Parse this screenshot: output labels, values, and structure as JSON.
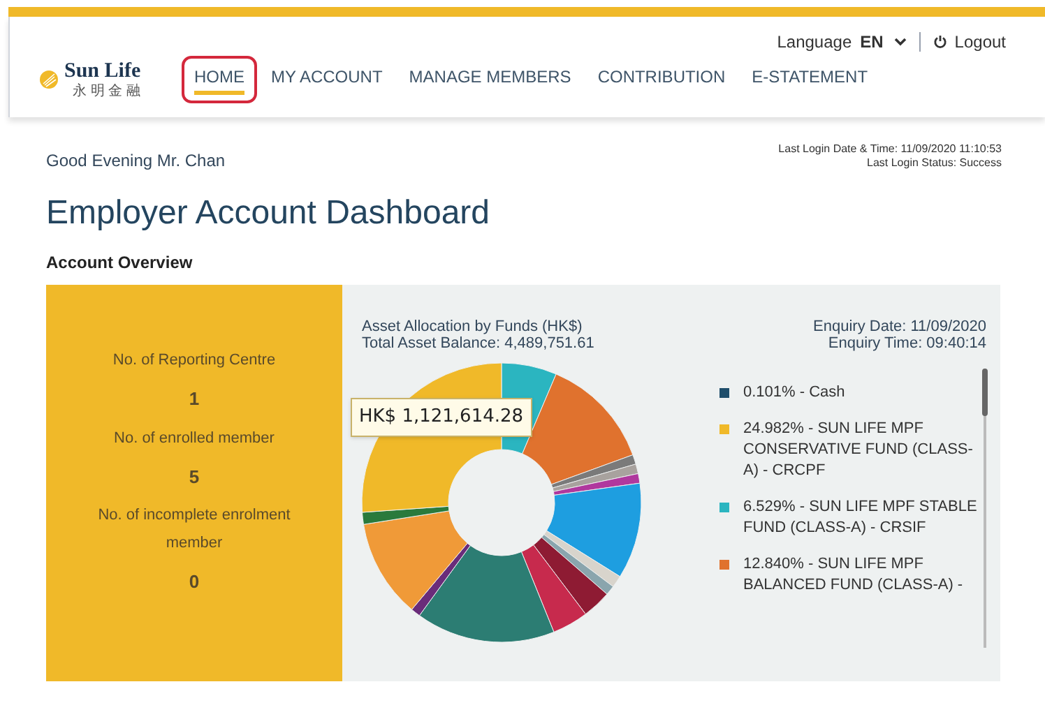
{
  "header": {
    "logo": {
      "name": "Sun Life",
      "subtitle": "永 明 金 融"
    },
    "language": {
      "label": "Language",
      "value": "EN"
    },
    "logout": "Logout",
    "nav": [
      {
        "label": "HOME",
        "selected": true
      },
      {
        "label": "MY ACCOUNT",
        "selected": false
      },
      {
        "label": "MANAGE MEMBERS",
        "selected": false
      },
      {
        "label": "CONTRIBUTION",
        "selected": false
      },
      {
        "label": "E-STATEMENT",
        "selected": false
      }
    ]
  },
  "greeting": "Good Evening Mr. Chan",
  "last_login": {
    "date_time": "Last Login Date & Time: 11/09/2020 11:10:53",
    "status": "Last Login Status: Success"
  },
  "title": "Employer Account Dashboard",
  "section_title": "Account Overview",
  "overview": [
    {
      "label": "No. of Reporting Centre",
      "value": "1"
    },
    {
      "label": "No. of enrolled member",
      "value": "5"
    },
    {
      "label": "No. of incomplete enrolment member",
      "value": "0"
    }
  ],
  "allocation": {
    "title": "Asset Allocation by Funds (HK$)",
    "total": "Total Asset Balance: 4,489,751.61",
    "enquiry_date": "Enquiry Date: 11/09/2020",
    "enquiry_time": "Enquiry Time: 09:40:14",
    "tooltip": "HK$ 1,121,614.28",
    "legend": [
      {
        "label": "0.101% - Cash",
        "color": "#1f4e6b"
      },
      {
        "label": "24.982% - SUN LIFE MPF CONSERVATIVE FUND (CLASS-A) - CRCPF",
        "color": "#f0b929"
      },
      {
        "label": "6.529% - SUN LIFE MPF STABLE FUND (CLASS-A) - CRSIF",
        "color": "#2bb5c0"
      },
      {
        "label": "12.840% - SUN LIFE MPF BALANCED FUND (CLASS-A) -",
        "color": "#e0722e"
      }
    ]
  }
}
